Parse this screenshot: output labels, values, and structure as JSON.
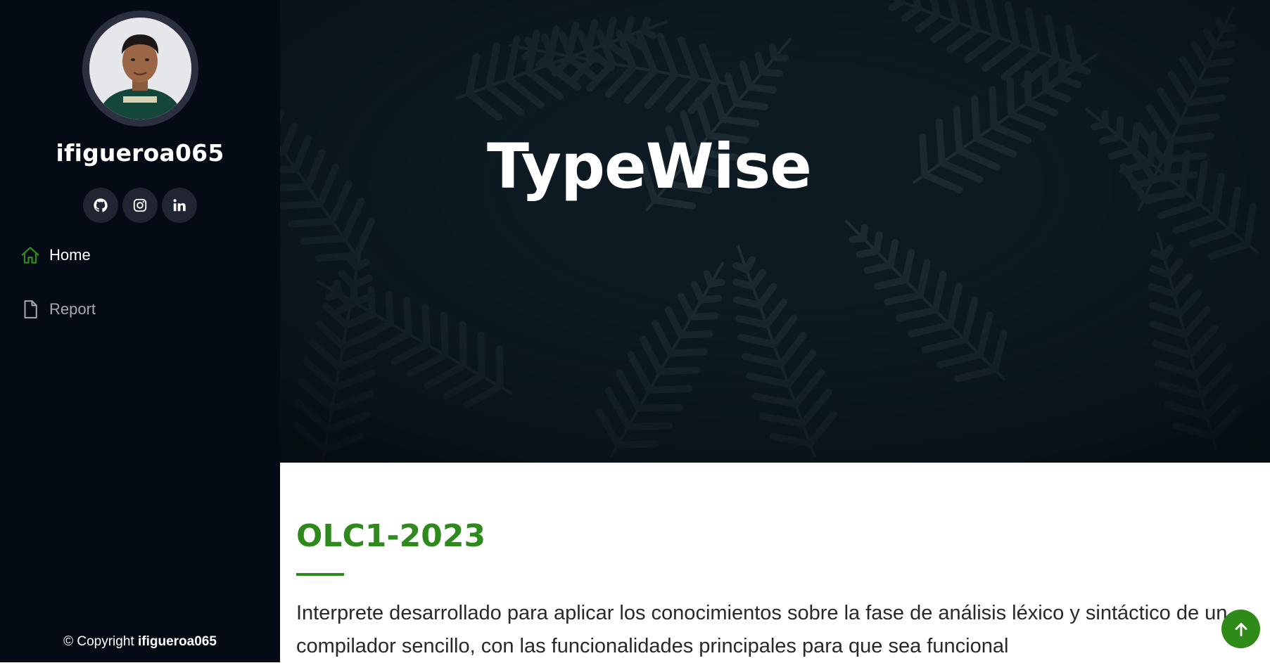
{
  "sidebar": {
    "username": "ifigueroa065",
    "social": [
      {
        "name": "github"
      },
      {
        "name": "instagram"
      },
      {
        "name": "linkedin"
      }
    ],
    "nav": [
      {
        "label": "Home",
        "icon": "home-icon",
        "active": true
      },
      {
        "label": "Report",
        "icon": "file-icon",
        "active": false
      }
    ],
    "copyright_prefix": "© Copyright",
    "copyright_name": "ifigueroa065"
  },
  "hero": {
    "title": "TypeWise"
  },
  "main": {
    "section_title": "OLC1-2023",
    "description": "Interprete desarrollado para aplicar los conocimientos sobre la fase de análisis léxico y sintáctico de un compilador sencillo, con las funcionalidades principales para que sea funcional"
  },
  "colors": {
    "accent": "#2f8a1d",
    "sidebar_bg": "#040b14",
    "social_bg": "#212431",
    "hero_bg": "#0b161d"
  }
}
